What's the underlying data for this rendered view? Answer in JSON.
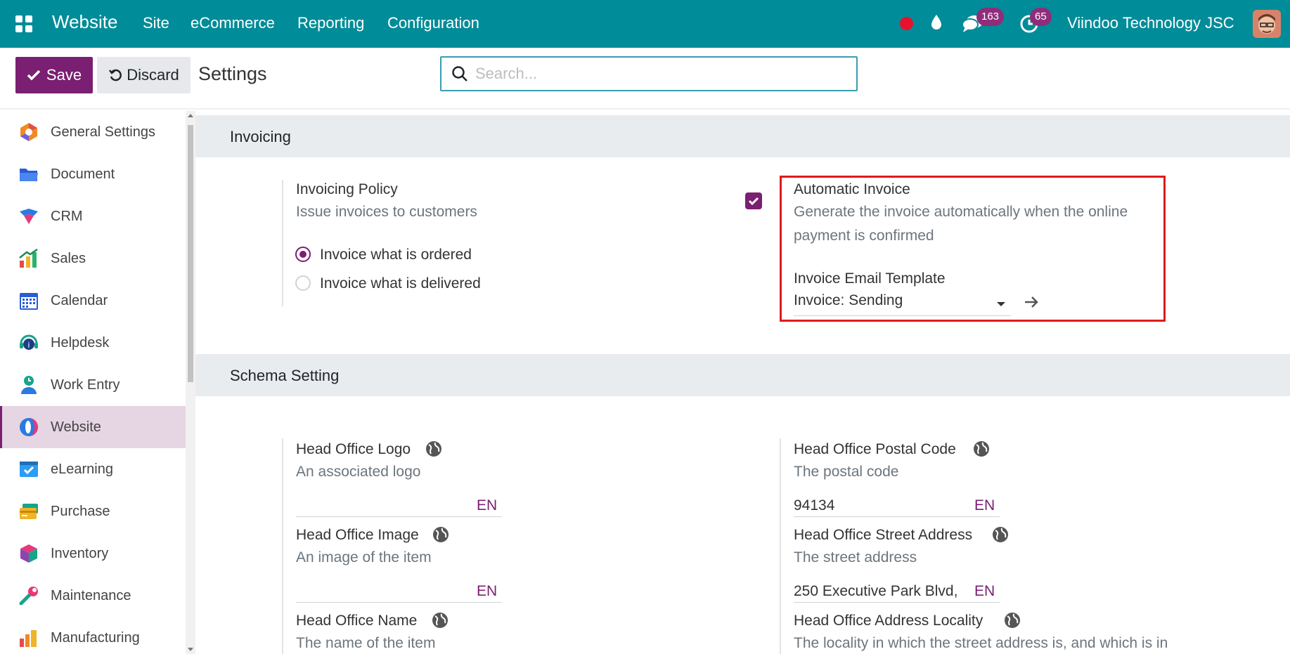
{
  "topbar": {
    "brand": "Website",
    "menus": [
      "Site",
      "eCommerce",
      "Reporting",
      "Configuration"
    ],
    "messages_count": "163",
    "activities_count": "65",
    "company": "Viindoo Technology JSC",
    "colors": {
      "bar": "#008c98",
      "badge": "#8f2d7a",
      "record": "#e8112d"
    }
  },
  "control_panel": {
    "save_label": "Save",
    "discard_label": "Discard",
    "title": "Settings",
    "search_placeholder": "Search..."
  },
  "sidebar": {
    "items": [
      {
        "label": "General Settings",
        "icon": "general-settings-icon"
      },
      {
        "label": "Document",
        "icon": "folder-icon"
      },
      {
        "label": "CRM",
        "icon": "crm-icon"
      },
      {
        "label": "Sales",
        "icon": "sales-chart-icon"
      },
      {
        "label": "Calendar",
        "icon": "calendar-icon"
      },
      {
        "label": "Helpdesk",
        "icon": "headset-icon"
      },
      {
        "label": "Work Entry",
        "icon": "person-clock-icon"
      },
      {
        "label": "Website",
        "icon": "website-icon",
        "active": true
      },
      {
        "label": "eLearning",
        "icon": "elearning-icon"
      },
      {
        "label": "Purchase",
        "icon": "purchase-card-icon"
      },
      {
        "label": "Inventory",
        "icon": "cube-icon"
      },
      {
        "label": "Maintenance",
        "icon": "wrench-icon"
      },
      {
        "label": "Manufacturing",
        "icon": "manufacturing-icon"
      }
    ]
  },
  "invoicing": {
    "section_title": "Invoicing",
    "policy_title": "Invoicing Policy",
    "policy_desc": "Issue invoices to customers",
    "options": [
      "Invoice what is ordered",
      "Invoice what is delivered"
    ],
    "selected_option": "Invoice what is ordered",
    "auto_invoice_title": "Automatic Invoice",
    "auto_invoice_desc": "Generate the invoice automatically when the online payment is confirmed",
    "auto_invoice_checked": true,
    "email_template_label": "Invoice Email Template",
    "email_template_value": "Invoice: Sending"
  },
  "schema": {
    "section_title": "Schema Setting",
    "logo_title": "Head Office Logo",
    "logo_desc": "An associated logo",
    "image_title": "Head Office Image",
    "image_desc": "An image of the item",
    "name_title": "Head Office Name",
    "name_desc": "The name of the item",
    "postal_title": "Head Office Postal Code",
    "postal_desc": "The postal code",
    "postal_value": "94134",
    "street_title": "Head Office Street Address",
    "street_desc": "The street address",
    "street_value": "250 Executive Park Blvd,",
    "locality_title": "Head Office Address Locality",
    "locality_desc": "The locality in which the street address is, and which is in",
    "lang": "EN"
  }
}
